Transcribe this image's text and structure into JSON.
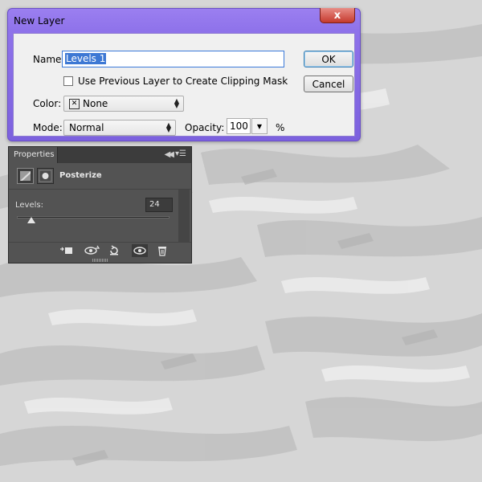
{
  "dialog": {
    "title": "New Layer",
    "close_label": "x",
    "name_label": "Name:",
    "name_value": "Levels 1",
    "ok_label": "OK",
    "cancel_label": "Cancel",
    "clipping_label": "Use Previous Layer to Create Clipping Mask",
    "color_label": "Color:",
    "color_value": "None",
    "mode_label": "Mode:",
    "mode_value": "Normal",
    "opacity_label": "Opacity:",
    "opacity_value": "100",
    "opacity_unit": "%"
  },
  "properties": {
    "tab_label": "Properties",
    "adjustment_title": "Posterize",
    "levels_label": "Levels:",
    "levels_value": "24",
    "icons": {
      "clip": "clip-to-layer-icon",
      "view_previous": "view-previous-state-icon",
      "reset": "reset-icon",
      "visibility": "eye-icon",
      "delete": "trash-icon"
    }
  },
  "colors": {
    "title_bar": "#8e72ea",
    "panel_bg": "#535353",
    "selection": "#3d78d4",
    "close_button": "#c53a2e"
  }
}
